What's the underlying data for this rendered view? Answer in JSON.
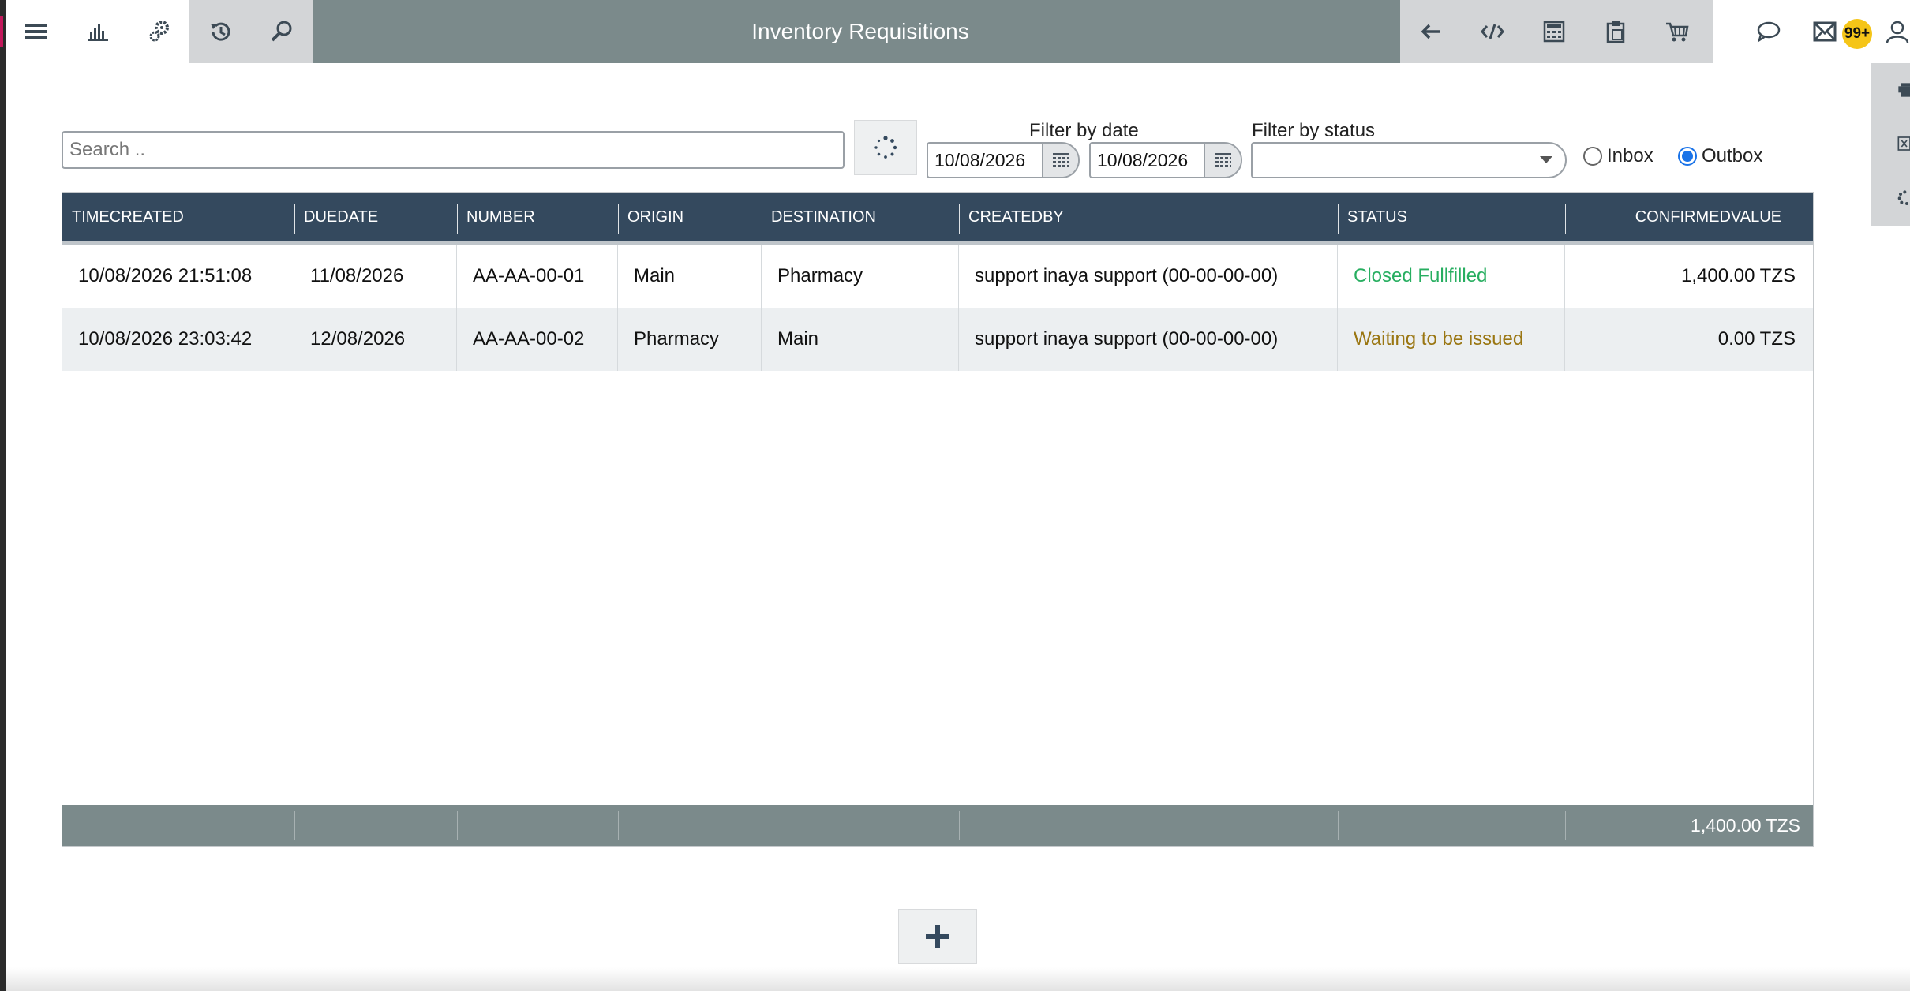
{
  "app": {
    "title": "Inventory Requisitions",
    "notification_count": "99+"
  },
  "toolbar_left": [
    {
      "icon": "hamburger-menu-icon"
    },
    {
      "icon": "bar-chart-icon"
    },
    {
      "icon": "settings-gears-icon"
    },
    {
      "icon": "history-icon"
    },
    {
      "icon": "search-icon"
    }
  ],
  "toolbar_right": [
    {
      "icon": "back-arrow-icon"
    },
    {
      "icon": "code-icon"
    },
    {
      "icon": "calculator-icon"
    },
    {
      "icon": "clipboard-icon"
    },
    {
      "icon": "cart-icon"
    },
    {
      "icon": "chat-icon"
    },
    {
      "icon": "mail-icon"
    },
    {
      "icon": "user-icon"
    }
  ],
  "filters": {
    "search_placeholder": "Search ..",
    "date_label": "Filter by date",
    "date_from": "10/08/2026",
    "date_to": "10/08/2026",
    "status_label": "Filter by status",
    "status_value": "",
    "inbox_label": "Inbox",
    "outbox_label": "Outbox",
    "selected_box": "Outbox"
  },
  "table": {
    "columns": [
      "TIMECREATED",
      "DUEDATE",
      "NUMBER",
      "ORIGIN",
      "DESTINATION",
      "CREATEDBY",
      "STATUS",
      "CONFIRMEDVALUE"
    ],
    "rows": [
      {
        "timecreated": "10/08/2026 21:51:08",
        "duedate": "11/08/2026",
        "number": "AA-AA-00-01",
        "origin": "Main",
        "destination": "Pharmacy",
        "createdby": "support inaya support (00-00-00-00)",
        "status": "Closed Fullfilled",
        "status_color": "#27ae60",
        "confirmedvalue": "1,400.00 TZS",
        "row_bg": "#ffffff"
      },
      {
        "timecreated": "10/08/2026 23:03:42",
        "duedate": "12/08/2026",
        "number": "AA-AA-00-02",
        "origin": "Pharmacy",
        "destination": "Main",
        "createdby": "support inaya support (00-00-00-00)",
        "status": "Waiting to be issued",
        "status_color": "#9a7612",
        "confirmedvalue": "0.00 TZS",
        "row_bg": "#eceff1"
      }
    ],
    "footer_total": "1,400.00 TZS"
  },
  "colors": {
    "header_bg": "#34495e",
    "toolbar_dark": "#7b8a8b",
    "toolbar_light": "#d3d5d7"
  }
}
